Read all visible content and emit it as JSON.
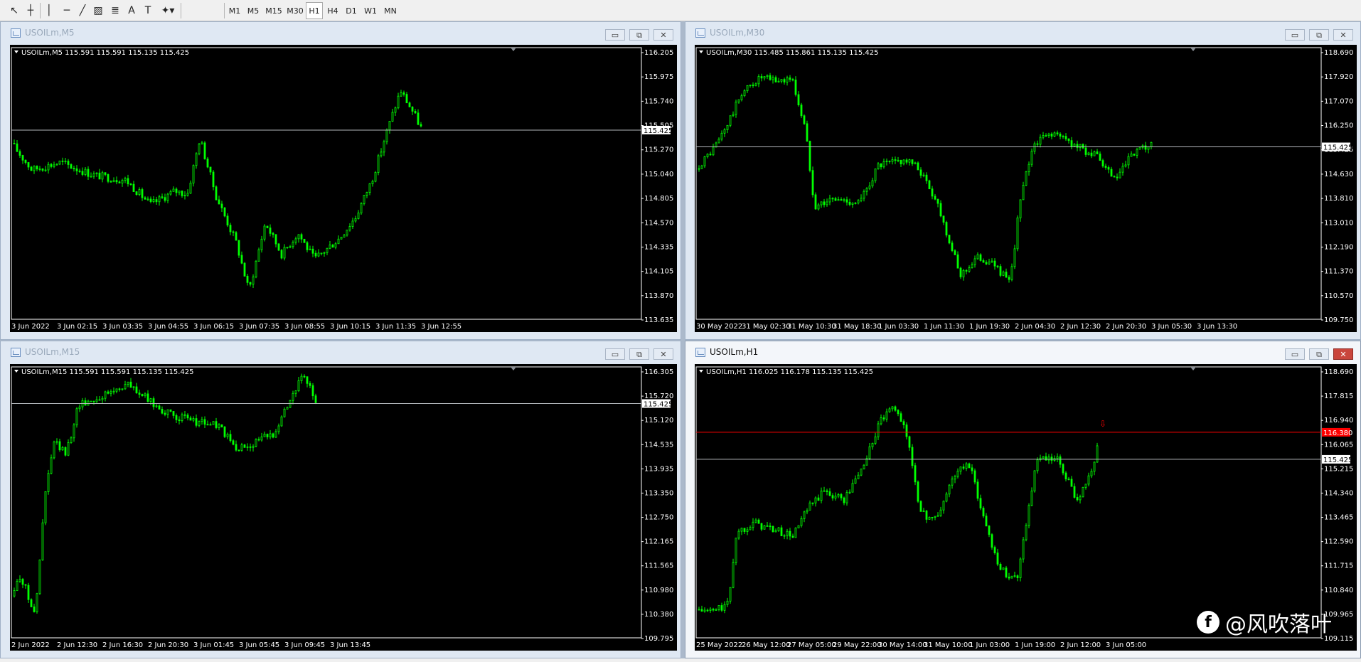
{
  "toolbar": {
    "tools": [
      {
        "name": "cursor-icon",
        "glyph": "↖"
      },
      {
        "name": "crosshair-icon",
        "glyph": "┼"
      },
      {
        "name": "vertical-line-icon",
        "glyph": "│"
      },
      {
        "name": "horizontal-line-icon",
        "glyph": "─"
      },
      {
        "name": "trendline-icon",
        "glyph": "╱"
      },
      {
        "name": "equidistant-channel-icon",
        "glyph": "▨"
      },
      {
        "name": "fibonacci-icon",
        "glyph": "≣"
      },
      {
        "name": "text-icon",
        "glyph": "A"
      },
      {
        "name": "text-label-icon",
        "glyph": "T"
      },
      {
        "name": "arrows-icon",
        "glyph": "✦▾"
      }
    ],
    "timeframes": [
      "M1",
      "M5",
      "M15",
      "M30",
      "H1",
      "H4",
      "D1",
      "W1",
      "MN"
    ],
    "active_timeframe": "H1"
  },
  "colors": {
    "chart_bg": "#000000",
    "candle": "#00ff00",
    "grid_line": "#8a8f96",
    "bid_line": "#b4b8bd",
    "alert_line": "#ff0000",
    "axis_text": "#ffffff"
  },
  "windows": [
    {
      "id": "m5",
      "title": "USOILm,M5",
      "active": false,
      "info_line": "USOILm,M5  115.591 115.591 115.135 115.425",
      "price_labels": [
        "116.205",
        "115.975",
        "115.740",
        "115.505",
        "115.270",
        "115.040",
        "114.805",
        "114.570",
        "114.335",
        "114.105",
        "113.870",
        "113.635"
      ],
      "time_labels": [
        "3 Jun 2022",
        "3 Jun 02:15",
        "3 Jun 03:35",
        "3 Jun 04:55",
        "3 Jun 06:15",
        "3 Jun 07:35",
        "3 Jun 08:55",
        "3 Jun 10:15",
        "3 Jun 11:35",
        "3 Jun 12:55"
      ],
      "current_price": "115.425"
    },
    {
      "id": "m30",
      "title": "USOILm,M30",
      "active": false,
      "info_line": "USOILm,M30  115.485 115.861 115.135 115.425",
      "price_labels": [
        "118.690",
        "117.920",
        "117.070",
        "116.250",
        "115.425",
        "114.630",
        "113.810",
        "113.010",
        "112.190",
        "111.370",
        "110.570",
        "109.750"
      ],
      "time_labels": [
        "30 May 2022",
        "31 May 02:30",
        "31 May 10:30",
        "31 May 18:30",
        "1 Jun 03:30",
        "1 Jun 11:30",
        "1 Jun 19:30",
        "2 Jun 04:30",
        "2 Jun 12:30",
        "2 Jun 20:30",
        "3 Jun 05:30",
        "3 Jun 13:30"
      ],
      "current_price": "115.425"
    },
    {
      "id": "m15",
      "title": "USOILm,M15",
      "active": false,
      "info_line": "USOILm,M15  115.591 115.591 115.135 115.425",
      "price_labels": [
        "116.305",
        "115.720",
        "115.120",
        "114.535",
        "113.935",
        "113.350",
        "112.750",
        "112.165",
        "111.565",
        "110.980",
        "110.380",
        "109.795"
      ],
      "time_labels": [
        "2 Jun 2022",
        "2 Jun 12:30",
        "2 Jun 16:30",
        "2 Jun 20:30",
        "3 Jun 01:45",
        "3 Jun 05:45",
        "3 Jun 09:45",
        "3 Jun 13:45"
      ],
      "current_price": "115.425"
    },
    {
      "id": "h1",
      "title": "USOILm,H1",
      "active": true,
      "info_line": "USOILm,H1  116.025 116.178 115.135 115.425",
      "price_labels": [
        "118.690",
        "117.815",
        "116.940",
        "116.065",
        "115.215",
        "114.340",
        "113.465",
        "112.590",
        "111.715",
        "110.840",
        "109.965",
        "109.115"
      ],
      "time_labels": [
        "25 May 2022",
        "26 May 12:00",
        "27 May 05:00",
        "29 May 22:00",
        "30 May 14:00",
        "31 May 10:00",
        "1 Jun 03:00",
        "1 Jun 19:00",
        "2 Jun 12:00",
        "3 Jun 05:00"
      ],
      "current_price": "115.425",
      "alert_price": "116.380"
    }
  ],
  "watermark": {
    "logo": "f",
    "text": "@风吹落叶"
  }
}
